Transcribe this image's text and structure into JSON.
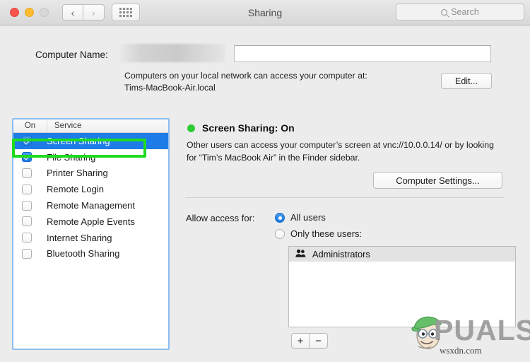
{
  "window": {
    "title": "Sharing",
    "traffic_lights": [
      {
        "name": "close",
        "color": "#f7544c"
      },
      {
        "name": "minimize",
        "color": "#fdbc2d"
      },
      {
        "name": "zoom",
        "color": "#d8d8d8"
      }
    ],
    "nav_back": "‹",
    "nav_forward": "›",
    "grid_button_label": "show-all",
    "search": {
      "placeholder": "Search",
      "value": "",
      "icon": "search-icon"
    }
  },
  "computer_name": {
    "label": "Computer Name:",
    "value": "",
    "placeholder": "",
    "redacted": true,
    "note_line1": "Computers on your local network can access your computer at:",
    "note_line2": "Tims-MacBook-Air.local",
    "edit_button": "Edit..."
  },
  "services": {
    "header": {
      "on": "On",
      "service": "Service"
    },
    "items": [
      {
        "label": "Screen Sharing",
        "checked": true,
        "selected": true
      },
      {
        "label": "File Sharing",
        "checked": true,
        "selected": false
      },
      {
        "label": "Printer Sharing",
        "checked": false,
        "selected": false
      },
      {
        "label": "Remote Login",
        "checked": false,
        "selected": false
      },
      {
        "label": "Remote Management",
        "checked": false,
        "selected": false
      },
      {
        "label": "Remote Apple Events",
        "checked": false,
        "selected": false
      },
      {
        "label": "Internet Sharing",
        "checked": false,
        "selected": false
      },
      {
        "label": "Bluetooth Sharing",
        "checked": false,
        "selected": false
      }
    ],
    "highlight_annotation_color": "#1fdb1f",
    "highlighted_item": "Screen Sharing"
  },
  "detail": {
    "status_dot_color": "#2ecc33",
    "status_title": "Screen Sharing: On",
    "description": "Other users can access your computer’s screen at vnc://10.0.0.14/ or by looking for “Tim’s MacBook Air” in the Finder sidebar.",
    "computer_settings_button": "Computer Settings..."
  },
  "access": {
    "label": "Allow access for:",
    "options": [
      {
        "label": "All users",
        "selected": true
      },
      {
        "label": "Only these users:",
        "selected": false
      }
    ],
    "users_list": [
      {
        "label": "Administrators",
        "icon": "group-icon"
      }
    ],
    "add_button": "+",
    "remove_button": "−"
  },
  "watermark": {
    "brand": "PUALS",
    "domain_text": "wsxdn.com",
    "mascot": "appuals-mascot-icon"
  }
}
